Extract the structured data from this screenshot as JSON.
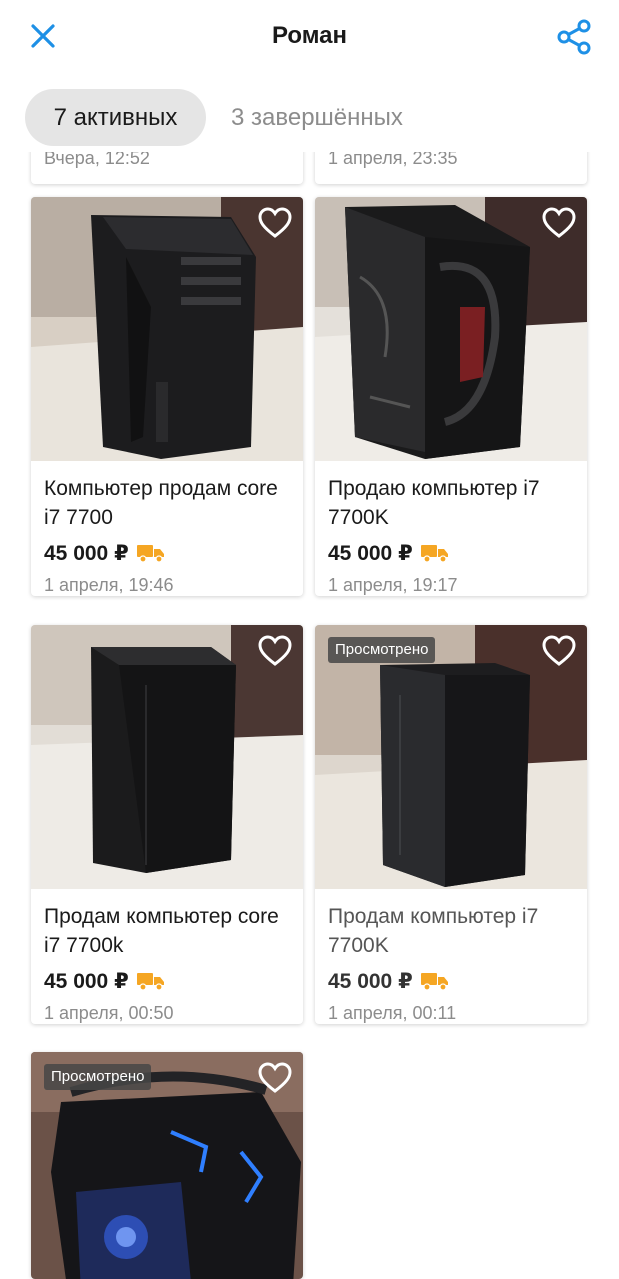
{
  "header": {
    "title": "Роман"
  },
  "tabs": {
    "active": "7 активных",
    "completed": "3 завершённых"
  },
  "partial_cards": [
    {
      "date": "Вчера, 12:52"
    },
    {
      "date": "1 апреля, 23:35"
    }
  ],
  "listings": [
    {
      "title": "Компьютер продам core i7 7700",
      "price": "45 000 ₽",
      "date": "1 апреля, 19:46",
      "viewed": false
    },
    {
      "title": "Продаю компьютер i7 7700K",
      "price": "45 000 ₽",
      "date": "1 апреля, 19:17",
      "viewed": false
    },
    {
      "title": "Продам компьютер core i7 7700k",
      "price": "45 000 ₽",
      "date": "1 апреля, 00:50",
      "viewed": false
    },
    {
      "title": "Продам компьютер i7 7700K",
      "price": "45 000 ₽",
      "date": "1 апреля, 00:11",
      "viewed": true,
      "badge": "Просмотрено"
    },
    {
      "title": "",
      "price": "",
      "date": "",
      "viewed": true,
      "badge": "Просмотрено"
    }
  ],
  "icons": {
    "close": "close-icon",
    "share": "share-icon",
    "favorite": "heart-outline-icon",
    "delivery": "truck-icon"
  },
  "colors": {
    "accent": "#1e90e6",
    "delivery": "#f5a623",
    "tab_active_bg": "#e5e5e5",
    "muted_text": "#8c8c8c"
  }
}
